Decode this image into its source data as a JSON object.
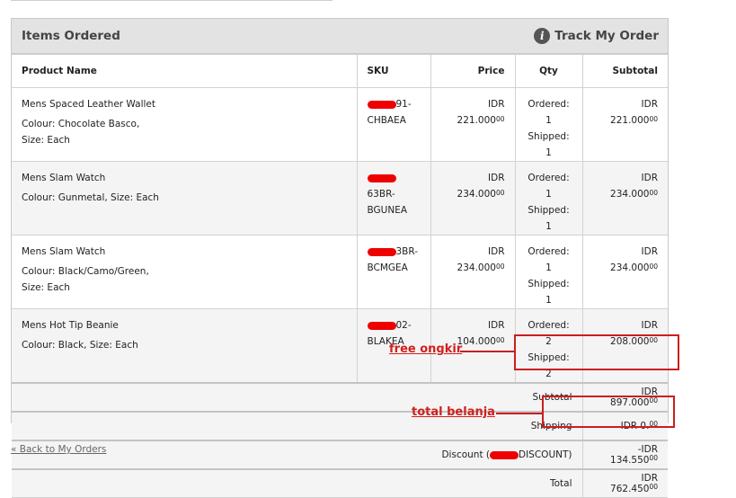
{
  "panel": {
    "title": "Items Ordered",
    "track_label": "Track My Order",
    "info_icon": "info-icon"
  },
  "columns": {
    "name": "Product Name",
    "sku": "SKU",
    "price": "Price",
    "qty": "Qty",
    "subtotal": "Subtotal"
  },
  "items": [
    {
      "name": "Mens Spaced Leather Wallet",
      "attrs": "Colour: Chocolate Basco, Size: Each",
      "sku_tail": "91-",
      "sku_line2": "CHBAEA",
      "price": "IDR 221.000",
      "price_dec": "00",
      "ordered": "Ordered: 1",
      "shipped": "Shipped: 1",
      "subtotal": "IDR 221.000",
      "subtotal_dec": "00"
    },
    {
      "name": "Mens Slam Watch",
      "attrs": "Colour: Gunmetal, Size: Each",
      "sku_tail": "63BR-",
      "sku_line2": "BGUNEA",
      "price": "IDR 234.000",
      "price_dec": "00",
      "ordered": "Ordered: 1",
      "shipped": "Shipped: 1",
      "subtotal": "IDR 234.000",
      "subtotal_dec": "00"
    },
    {
      "name": "Mens Slam Watch",
      "attrs": "Colour: Black/Camo/Green, Size: Each",
      "sku_tail": "3BR-",
      "sku_line2": "BCMGEA",
      "price": "IDR 234.000",
      "price_dec": "00",
      "ordered": "Ordered: 1",
      "shipped": "Shipped: 1",
      "subtotal": "IDR 234.000",
      "subtotal_dec": "00"
    },
    {
      "name": "Mens Hot Tip Beanie",
      "attrs": "Colour: Black, Size: Each",
      "sku_tail": "02-",
      "sku_line2": "BLAKEA",
      "price": "IDR 104.000",
      "price_dec": "00",
      "ordered": "Ordered: 2",
      "shipped": "Shipped: 2",
      "subtotal": "IDR 208.000",
      "subtotal_dec": "00"
    }
  ],
  "totals": {
    "subtotal_label": "Subtotal",
    "subtotal": "IDR 897.000",
    "subtotal_dec": "00",
    "shipping_label": "Shipping",
    "shipping": "IDR 0.",
    "shipping_dec": "00",
    "discount_prefix": "Discount (",
    "discount_suffix": "DISCOUNT)",
    "discount": "-IDR 134.550",
    "discount_dec": "00",
    "total_label": "Total",
    "total": "IDR 762.450",
    "total_dec": "00"
  },
  "annotations": {
    "free_shipping": "free ongkir",
    "total": "total belanja",
    "color": "#cc1e1e"
  },
  "back_link": "« Back to My Orders"
}
